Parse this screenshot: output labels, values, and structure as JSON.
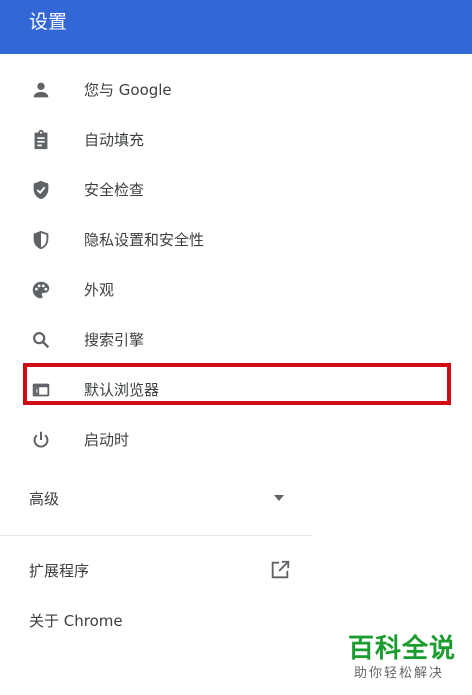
{
  "header": {
    "title": "设置"
  },
  "menu": [
    {
      "label": "您与 Google",
      "icon": "person-icon"
    },
    {
      "label": "自动填充",
      "icon": "clipboard-icon"
    },
    {
      "label": "安全检查",
      "icon": "shield-check-icon"
    },
    {
      "label": "隐私设置和安全性",
      "icon": "shield-half-icon"
    },
    {
      "label": "外观",
      "icon": "palette-icon"
    },
    {
      "label": "搜索引擎",
      "icon": "search-icon"
    },
    {
      "label": "默认浏览器",
      "icon": "browser-window-icon"
    },
    {
      "label": "启动时",
      "icon": "power-icon"
    }
  ],
  "advanced": {
    "label": "高级",
    "icon": "dropdown-arrow-icon"
  },
  "extensions": {
    "label": "扩展程序",
    "icon": "open-external-icon"
  },
  "about": {
    "label": "关于 Chrome"
  },
  "watermark": {
    "title": "百科全说",
    "subtitle": "助你轻松解决"
  },
  "colors": {
    "header": "#3367d6",
    "icon": "#5f6368",
    "text": "#3c4043",
    "highlight": "#d10c14",
    "watermark": "#1b9c2f"
  }
}
